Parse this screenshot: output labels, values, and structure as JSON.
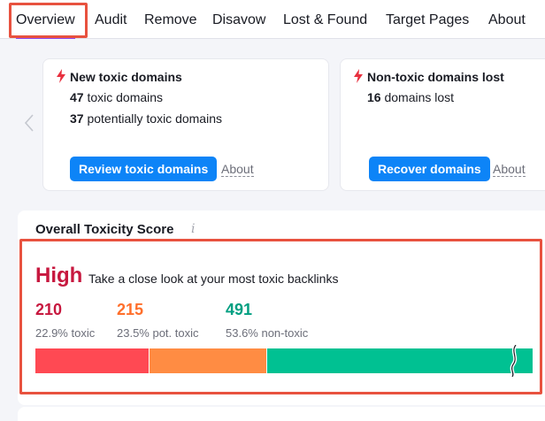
{
  "nav": {
    "items": [
      {
        "label": "Overview",
        "active": true
      },
      {
        "label": "Audit"
      },
      {
        "label": "Remove"
      },
      {
        "label": "Disavow"
      },
      {
        "label": "Lost & Found"
      },
      {
        "label": "Target Pages"
      },
      {
        "label": "About"
      }
    ]
  },
  "cards": [
    {
      "title": "New toxic domains",
      "lines": [
        {
          "num": "47",
          "text": "toxic domains"
        },
        {
          "num": "37",
          "text": "potentially toxic domains"
        }
      ],
      "button": "Review toxic domains",
      "about": "About"
    },
    {
      "title": "Non-toxic domains lost",
      "lines": [
        {
          "num": "16",
          "text": "domains lost"
        }
      ],
      "button": "Recover domains",
      "about": "About"
    }
  ],
  "toxicity": {
    "title": "Overall Toxicity Score",
    "info_icon": "i",
    "level": "High",
    "description": "Take a close look at your most toxic backlinks",
    "stats": [
      {
        "value": "210",
        "caption": "22.9% toxic",
        "color": "#c7183f",
        "share": 22.9
      },
      {
        "value": "215",
        "caption": "23.5% pot. toxic",
        "color": "#ff6f2b",
        "share": 23.5
      },
      {
        "value": "491",
        "caption": "53.6% non-toxic",
        "color": "#009f81",
        "share": 53.6
      }
    ],
    "bar_colors": [
      "#ff4953",
      "#ff8c43",
      "#00c192"
    ]
  },
  "icons": {
    "prev": "chevron-left-icon",
    "alert": "lightning-bolt-icon",
    "info": "info-icon"
  },
  "colors": {
    "primary_button": "#0d84f7",
    "highlight": "#e8523f"
  }
}
